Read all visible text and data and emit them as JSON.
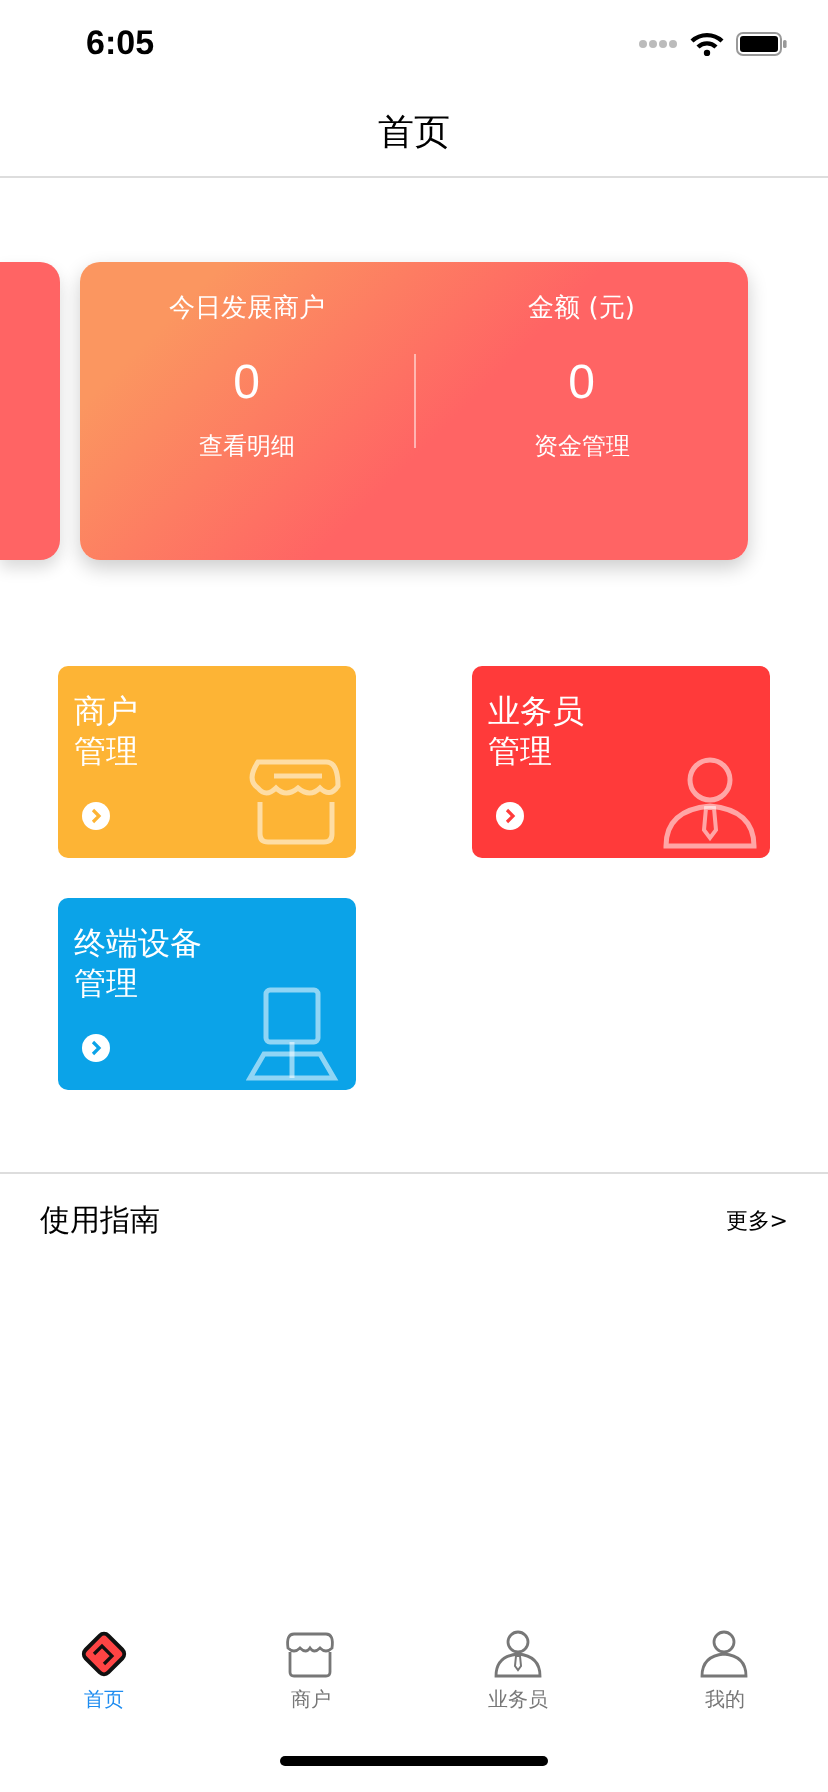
{
  "status_bar": {
    "time": "6:05"
  },
  "nav": {
    "title": "首页"
  },
  "summary_card": {
    "columns": [
      {
        "label": "今日发展商户",
        "value": "0",
        "link": "查看明细"
      },
      {
        "label": "金额 (元)",
        "value": "0",
        "link": "资金管理"
      }
    ]
  },
  "tiles": [
    {
      "kind": "shop",
      "title_lines": [
        "商户",
        "管理"
      ],
      "color": "#fdb435"
    },
    {
      "kind": "person",
      "title_lines": [
        "业务员",
        "管理"
      ],
      "color": "#ff3a3a"
    },
    {
      "kind": "terminal",
      "title_lines": [
        "终端设备",
        "管理"
      ],
      "color": "#0ba3e8"
    }
  ],
  "guide": {
    "title": "使用指南",
    "more": "更多>"
  },
  "tab_bar": [
    {
      "kind": "home",
      "label": "首页",
      "selected": true
    },
    {
      "kind": "shop",
      "label": "商户",
      "selected": false
    },
    {
      "kind": "person",
      "label": "业务员",
      "selected": false
    },
    {
      "kind": "user",
      "label": "我的",
      "selected": false
    }
  ]
}
